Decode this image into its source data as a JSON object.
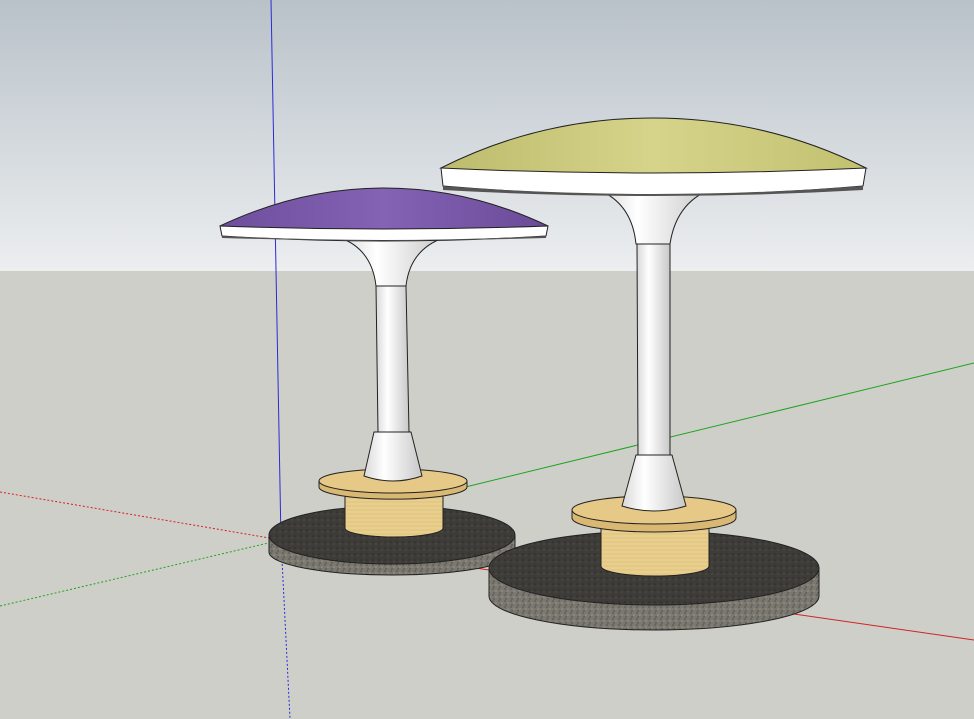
{
  "scene": {
    "colors": {
      "sky_top": "#b9c2c9",
      "sky_bottom": "#e9ecee",
      "ground": "#cfcfca",
      "axis_red": "#d22222",
      "axis_green": "#1fa31f",
      "axis_blue": "#2b2bd6",
      "stone_top": "#3f3d3a",
      "stone_side": "#7b7870",
      "wood_top": "#e6c887",
      "wood_side": "#ead496",
      "pillar": "#f4f4f4",
      "pillar_shade": "#cfcfcf",
      "cap_left": "#7a5aa8",
      "cap_right": "#c9c77a",
      "rim": "#ffffff",
      "rim_under": "#555555",
      "outline": "#222222"
    },
    "objects": [
      {
        "name": "left-mushroom-stool",
        "cap_color": "#7a5aa8"
      },
      {
        "name": "right-mushroom-stool",
        "cap_color": "#c9c77a"
      }
    ]
  }
}
